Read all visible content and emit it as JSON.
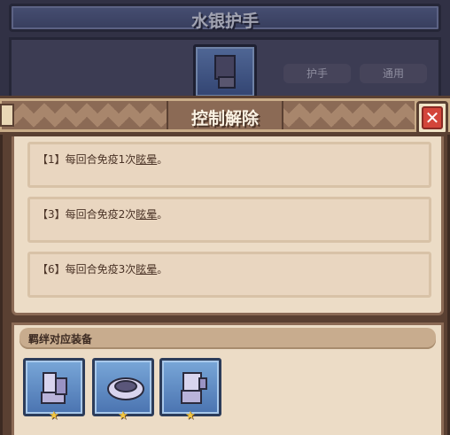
{
  "background": {
    "title": "水银护手",
    "tags": [
      "护手",
      "通用"
    ]
  },
  "dialog": {
    "title": "控制解除",
    "effects": [
      {
        "level": "【1】",
        "text": "每回合免疫1次",
        "keyword": "眩晕",
        "end": "。"
      },
      {
        "level": "【3】",
        "text": "每回合免疫2次",
        "keyword": "眩晕",
        "end": "。"
      },
      {
        "level": "【6】",
        "text": "每回合免疫3次",
        "keyword": "眩晕",
        "end": "。"
      }
    ],
    "equip_section_title": "羁绊对应装备",
    "equipment": [
      {
        "icon": "boots-icon",
        "stars": "★"
      },
      {
        "icon": "bracer-icon",
        "stars": "★"
      },
      {
        "icon": "gauntlet-icon",
        "stars": "★"
      }
    ]
  },
  "colors": {
    "accent": "#8b6a55",
    "close": "#d3453a",
    "star": "#f3c640"
  }
}
